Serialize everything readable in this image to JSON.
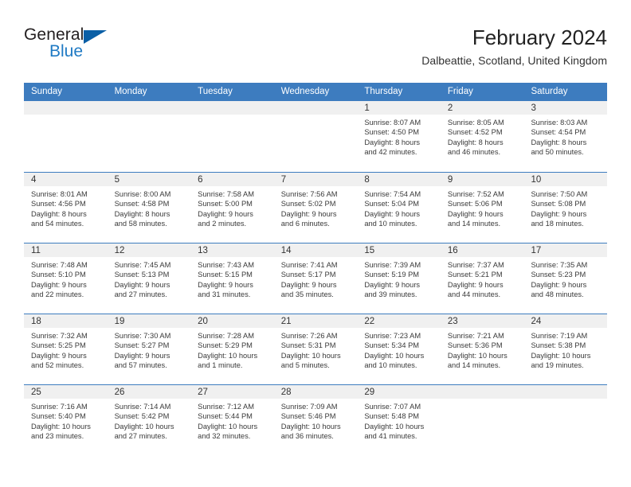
{
  "brand": {
    "name_top": "General",
    "name_bottom": "Blue",
    "accent_color": "#1f7ac4",
    "triangle_color": "#0a5fa6"
  },
  "header": {
    "title": "February 2024",
    "subtitle": "Dalbeattie, Scotland, United Kingdom",
    "header_bg_color": "#3d7cbf",
    "day_band_color": "#f0f0f0"
  },
  "weekdays": [
    "Sunday",
    "Monday",
    "Tuesday",
    "Wednesday",
    "Thursday",
    "Friday",
    "Saturday"
  ],
  "weeks": [
    [
      {
        "date": "",
        "empty": true
      },
      {
        "date": "",
        "empty": true
      },
      {
        "date": "",
        "empty": true
      },
      {
        "date": "",
        "empty": true
      },
      {
        "date": "1",
        "sunrise": "Sunrise: 8:07 AM",
        "sunset": "Sunset: 4:50 PM",
        "daylight1": "Daylight: 8 hours",
        "daylight2": "and 42 minutes."
      },
      {
        "date": "2",
        "sunrise": "Sunrise: 8:05 AM",
        "sunset": "Sunset: 4:52 PM",
        "daylight1": "Daylight: 8 hours",
        "daylight2": "and 46 minutes."
      },
      {
        "date": "3",
        "sunrise": "Sunrise: 8:03 AM",
        "sunset": "Sunset: 4:54 PM",
        "daylight1": "Daylight: 8 hours",
        "daylight2": "and 50 minutes."
      }
    ],
    [
      {
        "date": "4",
        "sunrise": "Sunrise: 8:01 AM",
        "sunset": "Sunset: 4:56 PM",
        "daylight1": "Daylight: 8 hours",
        "daylight2": "and 54 minutes."
      },
      {
        "date": "5",
        "sunrise": "Sunrise: 8:00 AM",
        "sunset": "Sunset: 4:58 PM",
        "daylight1": "Daylight: 8 hours",
        "daylight2": "and 58 minutes."
      },
      {
        "date": "6",
        "sunrise": "Sunrise: 7:58 AM",
        "sunset": "Sunset: 5:00 PM",
        "daylight1": "Daylight: 9 hours",
        "daylight2": "and 2 minutes."
      },
      {
        "date": "7",
        "sunrise": "Sunrise: 7:56 AM",
        "sunset": "Sunset: 5:02 PM",
        "daylight1": "Daylight: 9 hours",
        "daylight2": "and 6 minutes."
      },
      {
        "date": "8",
        "sunrise": "Sunrise: 7:54 AM",
        "sunset": "Sunset: 5:04 PM",
        "daylight1": "Daylight: 9 hours",
        "daylight2": "and 10 minutes."
      },
      {
        "date": "9",
        "sunrise": "Sunrise: 7:52 AM",
        "sunset": "Sunset: 5:06 PM",
        "daylight1": "Daylight: 9 hours",
        "daylight2": "and 14 minutes."
      },
      {
        "date": "10",
        "sunrise": "Sunrise: 7:50 AM",
        "sunset": "Sunset: 5:08 PM",
        "daylight1": "Daylight: 9 hours",
        "daylight2": "and 18 minutes."
      }
    ],
    [
      {
        "date": "11",
        "sunrise": "Sunrise: 7:48 AM",
        "sunset": "Sunset: 5:10 PM",
        "daylight1": "Daylight: 9 hours",
        "daylight2": "and 22 minutes."
      },
      {
        "date": "12",
        "sunrise": "Sunrise: 7:45 AM",
        "sunset": "Sunset: 5:13 PM",
        "daylight1": "Daylight: 9 hours",
        "daylight2": "and 27 minutes."
      },
      {
        "date": "13",
        "sunrise": "Sunrise: 7:43 AM",
        "sunset": "Sunset: 5:15 PM",
        "daylight1": "Daylight: 9 hours",
        "daylight2": "and 31 minutes."
      },
      {
        "date": "14",
        "sunrise": "Sunrise: 7:41 AM",
        "sunset": "Sunset: 5:17 PM",
        "daylight1": "Daylight: 9 hours",
        "daylight2": "and 35 minutes."
      },
      {
        "date": "15",
        "sunrise": "Sunrise: 7:39 AM",
        "sunset": "Sunset: 5:19 PM",
        "daylight1": "Daylight: 9 hours",
        "daylight2": "and 39 minutes."
      },
      {
        "date": "16",
        "sunrise": "Sunrise: 7:37 AM",
        "sunset": "Sunset: 5:21 PM",
        "daylight1": "Daylight: 9 hours",
        "daylight2": "and 44 minutes."
      },
      {
        "date": "17",
        "sunrise": "Sunrise: 7:35 AM",
        "sunset": "Sunset: 5:23 PM",
        "daylight1": "Daylight: 9 hours",
        "daylight2": "and 48 minutes."
      }
    ],
    [
      {
        "date": "18",
        "sunrise": "Sunrise: 7:32 AM",
        "sunset": "Sunset: 5:25 PM",
        "daylight1": "Daylight: 9 hours",
        "daylight2": "and 52 minutes."
      },
      {
        "date": "19",
        "sunrise": "Sunrise: 7:30 AM",
        "sunset": "Sunset: 5:27 PM",
        "daylight1": "Daylight: 9 hours",
        "daylight2": "and 57 minutes."
      },
      {
        "date": "20",
        "sunrise": "Sunrise: 7:28 AM",
        "sunset": "Sunset: 5:29 PM",
        "daylight1": "Daylight: 10 hours",
        "daylight2": "and 1 minute."
      },
      {
        "date": "21",
        "sunrise": "Sunrise: 7:26 AM",
        "sunset": "Sunset: 5:31 PM",
        "daylight1": "Daylight: 10 hours",
        "daylight2": "and 5 minutes."
      },
      {
        "date": "22",
        "sunrise": "Sunrise: 7:23 AM",
        "sunset": "Sunset: 5:34 PM",
        "daylight1": "Daylight: 10 hours",
        "daylight2": "and 10 minutes."
      },
      {
        "date": "23",
        "sunrise": "Sunrise: 7:21 AM",
        "sunset": "Sunset: 5:36 PM",
        "daylight1": "Daylight: 10 hours",
        "daylight2": "and 14 minutes."
      },
      {
        "date": "24",
        "sunrise": "Sunrise: 7:19 AM",
        "sunset": "Sunset: 5:38 PM",
        "daylight1": "Daylight: 10 hours",
        "daylight2": "and 19 minutes."
      }
    ],
    [
      {
        "date": "25",
        "sunrise": "Sunrise: 7:16 AM",
        "sunset": "Sunset: 5:40 PM",
        "daylight1": "Daylight: 10 hours",
        "daylight2": "and 23 minutes."
      },
      {
        "date": "26",
        "sunrise": "Sunrise: 7:14 AM",
        "sunset": "Sunset: 5:42 PM",
        "daylight1": "Daylight: 10 hours",
        "daylight2": "and 27 minutes."
      },
      {
        "date": "27",
        "sunrise": "Sunrise: 7:12 AM",
        "sunset": "Sunset: 5:44 PM",
        "daylight1": "Daylight: 10 hours",
        "daylight2": "and 32 minutes."
      },
      {
        "date": "28",
        "sunrise": "Sunrise: 7:09 AM",
        "sunset": "Sunset: 5:46 PM",
        "daylight1": "Daylight: 10 hours",
        "daylight2": "and 36 minutes."
      },
      {
        "date": "29",
        "sunrise": "Sunrise: 7:07 AM",
        "sunset": "Sunset: 5:48 PM",
        "daylight1": "Daylight: 10 hours",
        "daylight2": "and 41 minutes."
      },
      {
        "date": "",
        "empty": true
      },
      {
        "date": "",
        "empty": true
      }
    ]
  ]
}
